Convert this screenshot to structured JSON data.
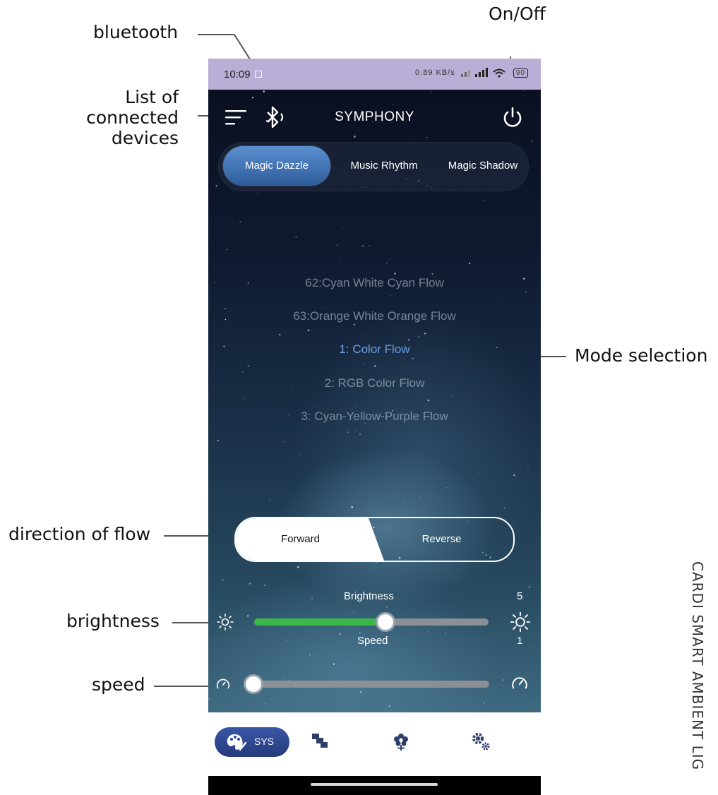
{
  "annotations": {
    "bluetooth": "bluetooth",
    "onoff": "On/Off",
    "devices_l1": "List of",
    "devices_l2": "connected",
    "devices_l3": "devices",
    "mode_selection": "Mode selection",
    "direction": "direction of flow",
    "brightness": "brightness",
    "speed": "speed",
    "side_text": "CARDI SMART AMBIENT LIG"
  },
  "status_bar": {
    "time": "10:09",
    "net_speed": "0.89 KB/s",
    "battery": "90"
  },
  "app": {
    "title": "SYMPHONY"
  },
  "mode_tabs": [
    {
      "label": "Magic Dazzle",
      "active": true
    },
    {
      "label": "Music Rhythm",
      "active": false
    },
    {
      "label": "Magic Shadow",
      "active": false
    }
  ],
  "modes": [
    {
      "label": "62:Cyan White Cyan Flow",
      "selected": false
    },
    {
      "label": "63:Orange White Orange Flow",
      "selected": false
    },
    {
      "label": "1: Color Flow",
      "selected": true
    },
    {
      "label": "2: RGB Color Flow",
      "selected": false
    },
    {
      "label": "3: Cyan-Yellow-Purple Flow",
      "selected": false
    }
  ],
  "direction": {
    "forward": "Forward",
    "reverse": "Reverse",
    "selected": "Forward"
  },
  "brightness": {
    "label": "Brightness",
    "value": "5",
    "fraction": 0.56
  },
  "speed": {
    "label": "Speed",
    "value": "1",
    "fraction": 0.0
  },
  "bottom_nav": {
    "sys_label": "SYS",
    "items": [
      "palette-icon",
      "layers-icon",
      "flower-icon",
      "gears-icon"
    ]
  },
  "colors": {
    "status_bar": "#b9aed6",
    "tab_active": "#3f73b8",
    "selected_mode": "#6f9fe6",
    "brightness_fill": "#3bb84a",
    "nav_pill": "#2c4590"
  }
}
